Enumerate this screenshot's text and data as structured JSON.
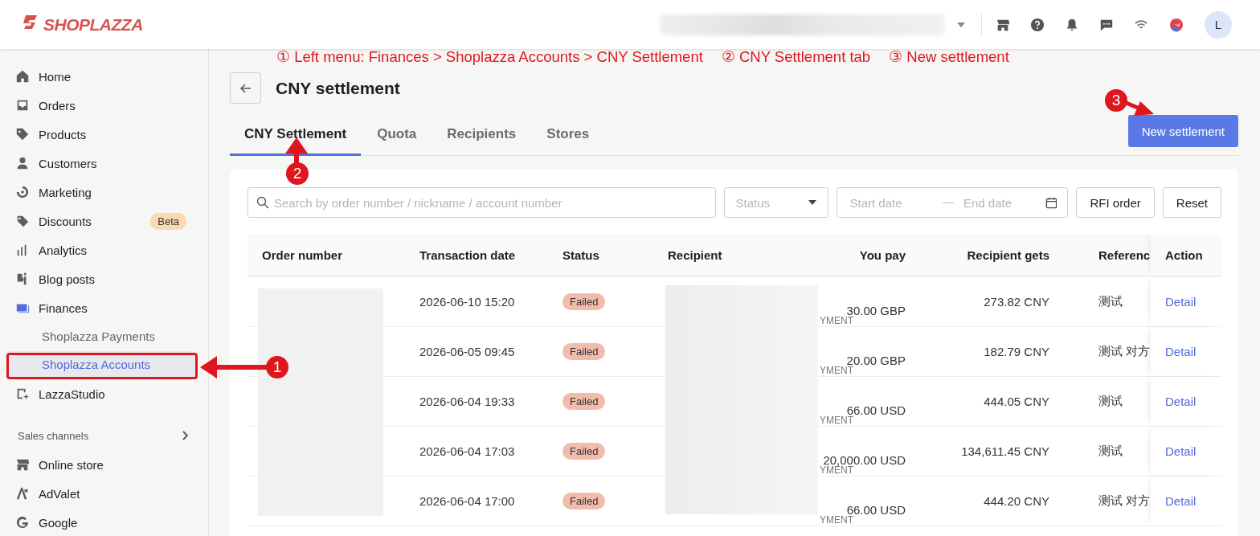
{
  "top_bar": {
    "logo": "SHOPLAZZA",
    "avatar": "L"
  },
  "sidebar": {
    "items": [
      {
        "label": "Home",
        "selected": false
      },
      {
        "label": "Orders",
        "selected": false
      },
      {
        "label": "Products",
        "selected": false
      },
      {
        "label": "Customers",
        "selected": false
      },
      {
        "label": "Marketing",
        "selected": false
      },
      {
        "label": "Discounts",
        "selected": false,
        "badge": "Beta"
      },
      {
        "label": "Analytics",
        "selected": false
      },
      {
        "label": "Blog posts",
        "selected": false
      },
      {
        "label": "Finances",
        "selected": false,
        "children": [
          {
            "label": "Shoplazza Payments",
            "selected": false
          },
          {
            "label": "Shoplazza Accounts",
            "selected": true
          }
        ]
      },
      {
        "label": "LazzaStudio",
        "selected": false
      }
    ],
    "section": {
      "title": "Sales channels",
      "items": [
        {
          "label": "Online store",
          "selected": false
        },
        {
          "label": "AdValet",
          "selected": false
        },
        {
          "label": "Google",
          "selected": false
        }
      ]
    }
  },
  "annotations": {
    "captions": [
      "① Left menu: Finances > Shoplazza Accounts > CNY Settlement",
      "② CNY Settlement tab",
      "③ New settlement"
    ],
    "markers": [
      {
        "label": "1"
      },
      {
        "label": "2"
      },
      {
        "label": "3"
      }
    ]
  },
  "page": {
    "title": "CNY settlement",
    "primary_button": "New settlement"
  },
  "tabs": [
    {
      "label": "CNY Settlement",
      "selected": true
    },
    {
      "label": "Quota",
      "selected": false
    },
    {
      "label": "Recipients",
      "selected": false
    },
    {
      "label": "Stores",
      "selected": false
    }
  ],
  "filters": {
    "search": {
      "placeholder": "Search by order number / nickname / account number"
    },
    "status": {
      "placeholder": "Status"
    },
    "start_date": {
      "placeholder": "Start date"
    },
    "end_date": {
      "placeholder": "End date"
    },
    "buttons": [
      "RFI order",
      "Reset"
    ]
  },
  "table": {
    "columns": [
      "Order number",
      "Transaction date",
      "Status",
      "Recipient",
      "You pay",
      "Recipient gets",
      "Referenc",
      "Action"
    ],
    "rows": [
      {
        "date": "2026-06-10 15:20",
        "status": {
          "label": "Failed",
          "kind": "failed"
        },
        "recipient_tail": "YMENT",
        "you_pay": "30.00 GBP",
        "gets": "273.82 CNY",
        "reference": "测试",
        "action": "Detail"
      },
      {
        "date": "2026-06-05 09:45",
        "status": {
          "label": "Failed",
          "kind": "failed"
        },
        "recipient_tail": "YMENT",
        "you_pay": "20.00 GBP",
        "gets": "182.79 CNY",
        "reference": "测试 对方",
        "action": "Detail"
      },
      {
        "date": "2026-06-04 19:33",
        "status": {
          "label": "Failed",
          "kind": "failed"
        },
        "recipient_tail": "YMENT",
        "you_pay": "66.00 USD",
        "gets": "444.05 CNY",
        "reference": "测试",
        "action": "Detail"
      },
      {
        "date": "2026-06-04 17:03",
        "status": {
          "label": "Failed",
          "kind": "failed"
        },
        "recipient_tail": "YMENT",
        "you_pay": "20,000.00 USD",
        "gets": "134,611.45 CNY",
        "reference": "测试",
        "action": "Detail"
      },
      {
        "date": "2026-06-04 17:00",
        "status": {
          "label": "Failed",
          "kind": "failed"
        },
        "recipient_tail": "YMENT",
        "you_pay": "66.00 USD",
        "gets": "444.20 CNY",
        "reference": "测试 对方",
        "action": "Detail"
      }
    ]
  }
}
